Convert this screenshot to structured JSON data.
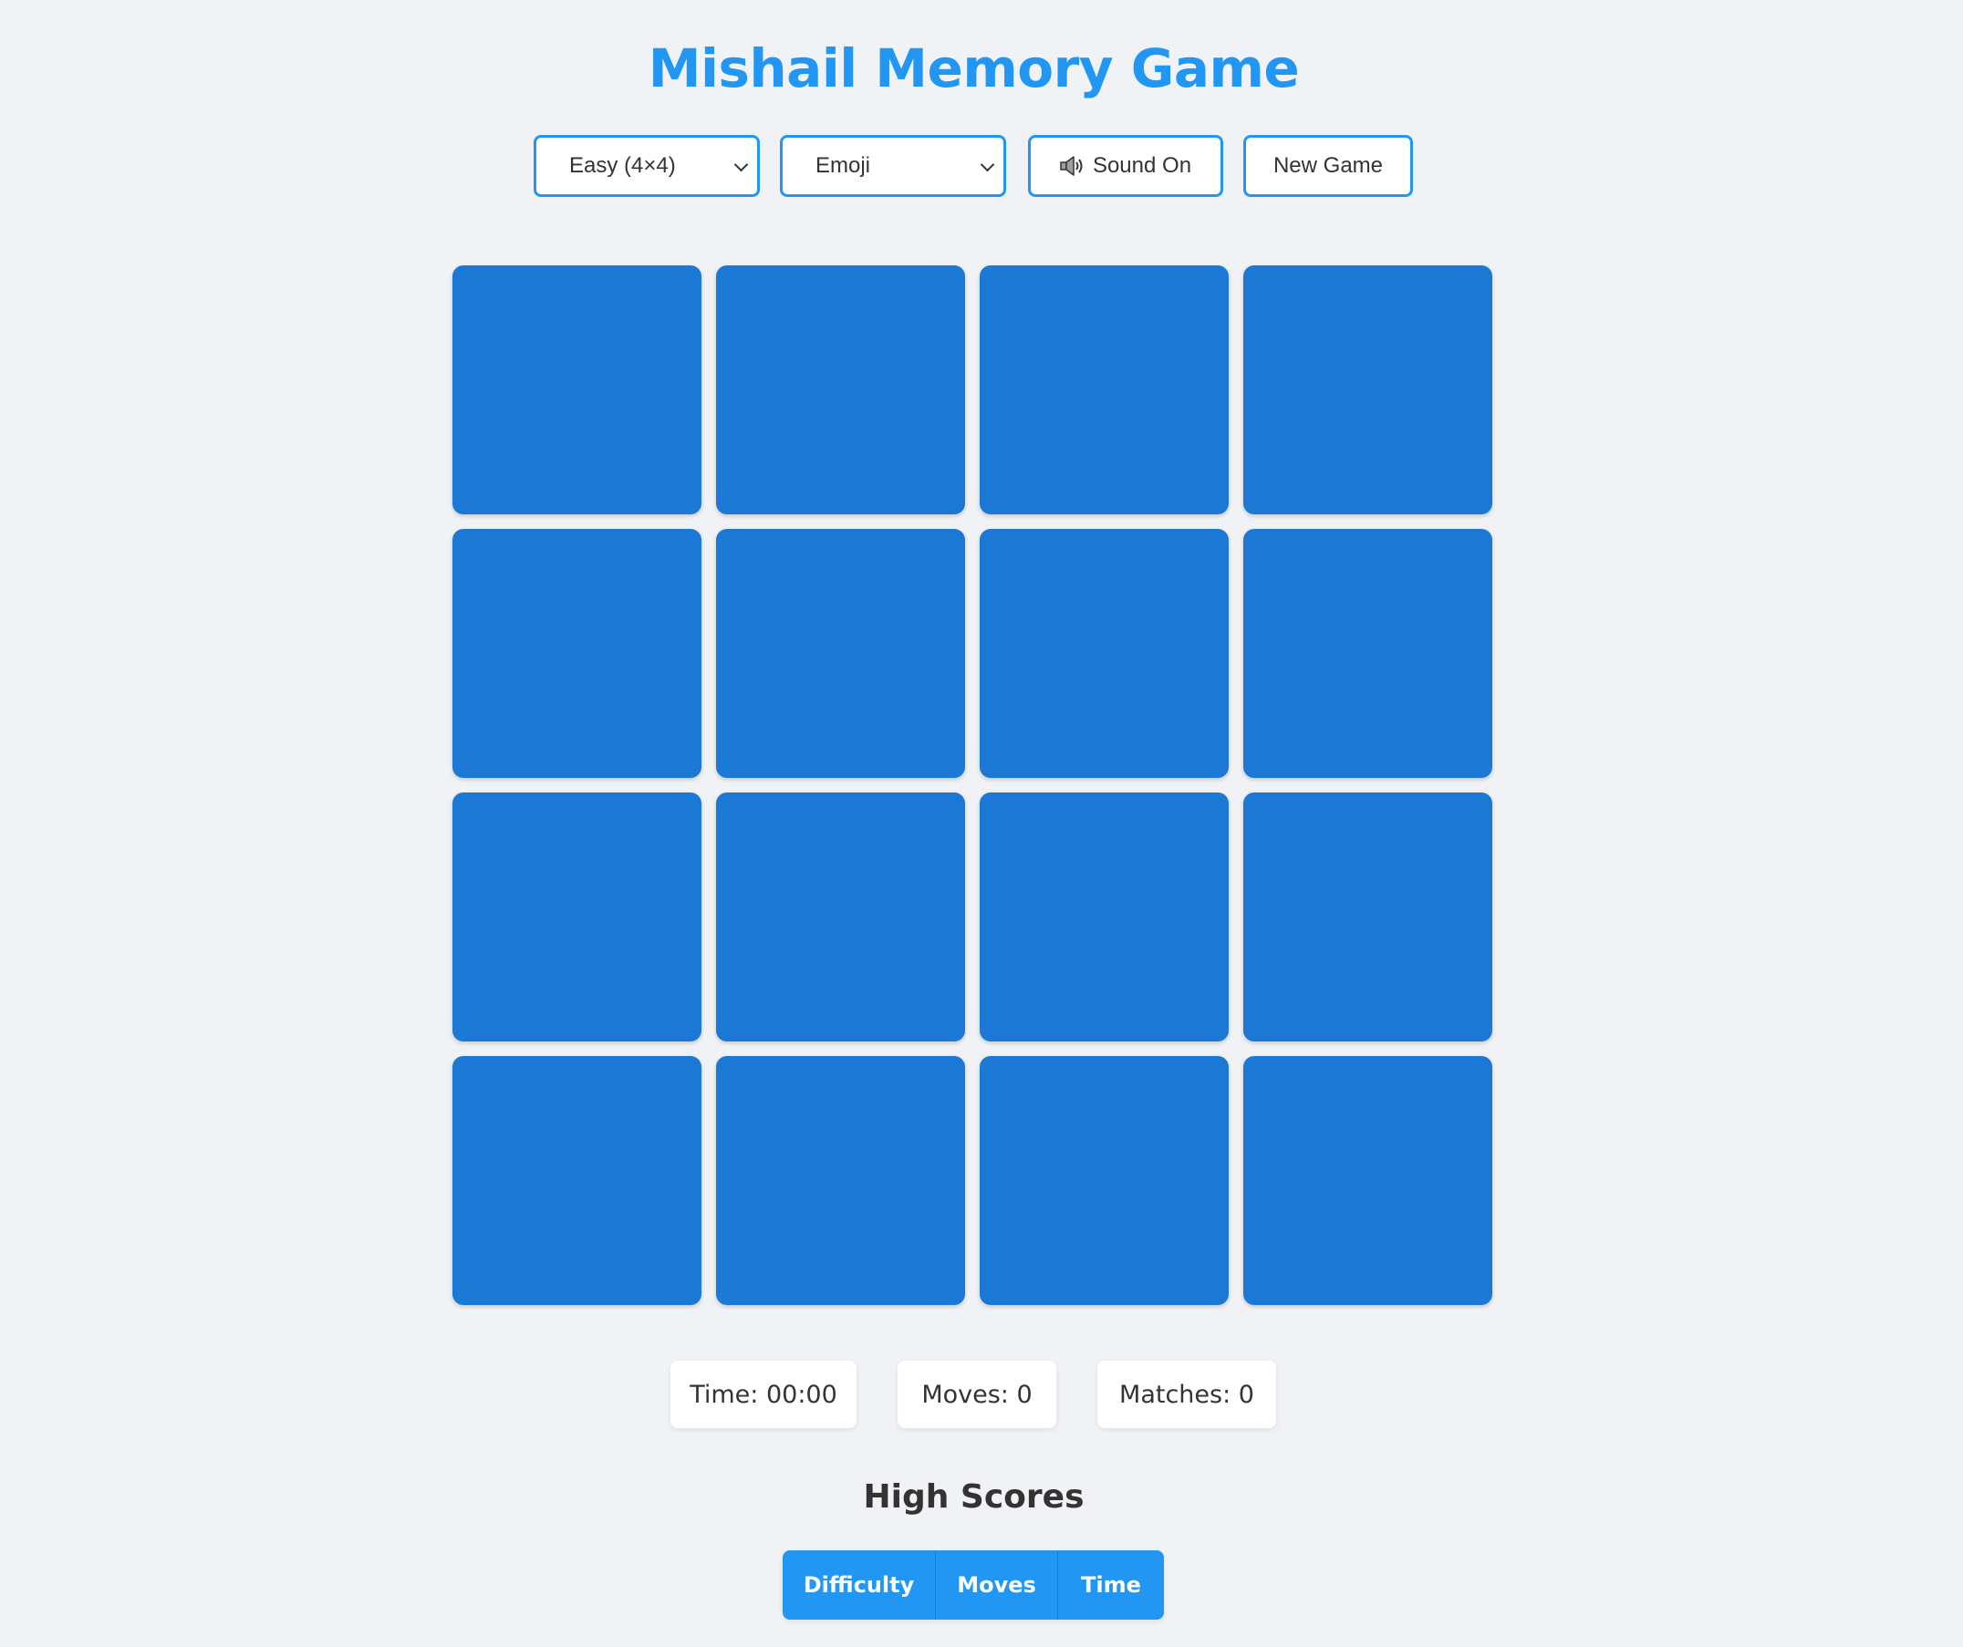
{
  "title": "Mishail Memory Game",
  "controls": {
    "difficulty": {
      "selected": "Easy (4×4)"
    },
    "theme": {
      "selected": "Emoji"
    },
    "sound_label": "Sound On",
    "sound_icon": "speaker-icon",
    "new_game_label": "New Game"
  },
  "board": {
    "rows": 4,
    "columns": 4,
    "card_back_color": "#1b78d4",
    "cards_face_down": 16
  },
  "stats": {
    "time": "Time: 00:00",
    "moves": "Moves: 0",
    "matches": "Matches: 0"
  },
  "high_scores": {
    "heading": "High Scores",
    "columns": [
      "Difficulty",
      "Moves",
      "Time"
    ]
  },
  "colors": {
    "accent": "#2196f3",
    "background": "#f0f2f5",
    "text": "#333333"
  }
}
